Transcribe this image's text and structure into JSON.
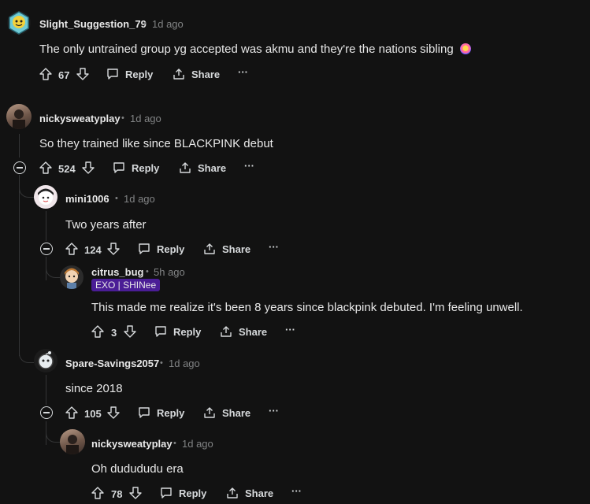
{
  "comments": [
    {
      "username": "Slight_Suggestion_79",
      "time": "1d ago",
      "text": "The only untrained group yg accepted was akmu and they're the nations sibling",
      "votes": "67",
      "reply": "Reply",
      "share": "Share",
      "more": "···"
    },
    {
      "username": "nickysweatyplay",
      "time": "1d ago",
      "text": "So they trained like since BLACKPINK debut",
      "votes": "524",
      "reply": "Reply",
      "share": "Share",
      "more": "···"
    },
    {
      "username": "mini1006",
      "time": "1d ago",
      "text": "Two years after",
      "votes": "124",
      "reply": "Reply",
      "share": "Share",
      "more": "···"
    },
    {
      "username": "citrus_bug",
      "time": "5h ago",
      "flair": "EXO | SHINee",
      "text": "This made me realize it's been 8 years since blackpink debuted. I'm feeling unwell.",
      "votes": "3",
      "reply": "Reply",
      "share": "Share",
      "more": "···"
    },
    {
      "username": "Spare-Savings2057",
      "time": "1d ago",
      "text": "since 2018",
      "votes": "105",
      "reply": "Reply",
      "share": "Share",
      "more": "···"
    },
    {
      "username": "nickysweatyplay",
      "time": "1d ago",
      "text": "Oh dudududu era",
      "votes": "78",
      "reply": "Reply",
      "share": "Share",
      "more": "···"
    }
  ],
  "separator": "•",
  "emoji_icon": "rainbow-face-emoji",
  "colors": {
    "background": "#121212",
    "text": "#d7dadc",
    "muted": "#818384",
    "flair": "#4a1d96"
  }
}
